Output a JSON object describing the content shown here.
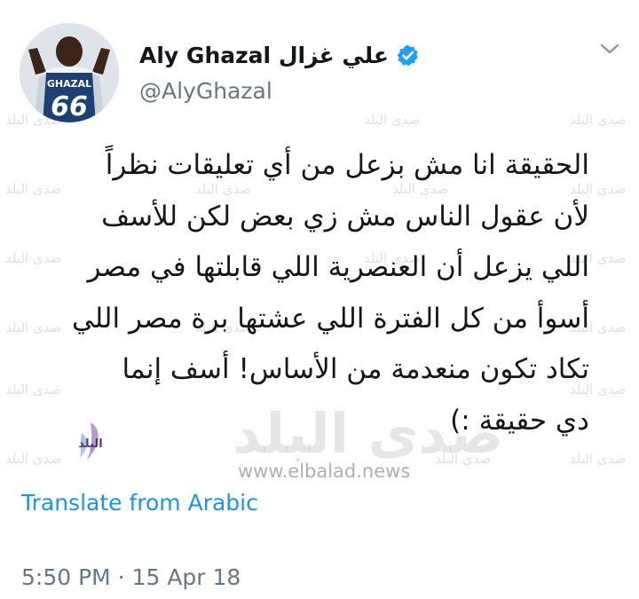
{
  "tweet": {
    "display_name": "Aly Ghazal علي غزال",
    "handle": "@AlyGhazal",
    "text_lines": [
      "الحقيقة انا مش بزعل من أي تعليقات نظراً",
      "لأن عقول الناس مش زي بعض لكن للأسف",
      "اللي يزعل أن العنصرية اللي قابلتها في مصر",
      "أسوأ من كل الفترة اللي عشتها برة مصر اللي",
      "تكاد تكون منعدمة من الأساس! أسف إنما",
      "دي حقيقة :)"
    ],
    "translate_label": "Translate from Arabic",
    "timestamp": "5:50 PM · 15 Apr 18"
  },
  "avatar": {
    "jersey_name": "GHAZAL",
    "jersey_number": "66"
  },
  "watermark": {
    "small_text": "صدى البلد",
    "big_text": "صدى البلد",
    "url": "www.elbalad.news",
    "logo_text": "البلد"
  },
  "icons": {
    "verified": "verified-badge-icon",
    "caret": "chevron-down-icon"
  },
  "colors": {
    "link": "#1b95e0",
    "verified": "#1da1f2",
    "secondary_text": "#657786",
    "primary_text": "#14171a"
  }
}
